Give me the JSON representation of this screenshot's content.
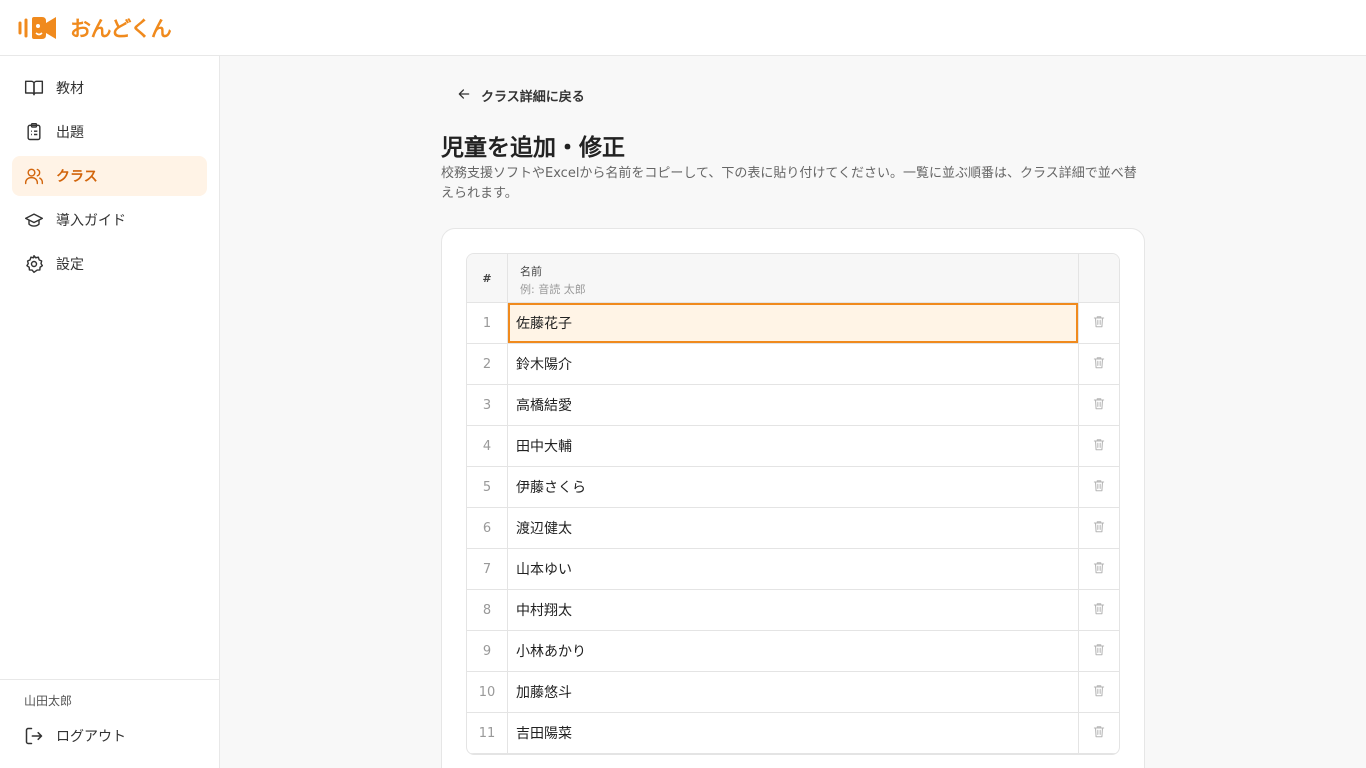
{
  "app": {
    "logo_text": "おんどくん"
  },
  "sidebar": {
    "items": [
      {
        "label": "教材",
        "icon": "book-icon",
        "active": false
      },
      {
        "label": "出題",
        "icon": "clipboard-icon",
        "active": false
      },
      {
        "label": "クラス",
        "icon": "users-icon",
        "active": true
      },
      {
        "label": "導入ガイド",
        "icon": "graduation-cap-icon",
        "active": false
      },
      {
        "label": "設定",
        "icon": "gear-icon",
        "active": false
      }
    ],
    "user_name": "山田太郎",
    "logout_label": "ログアウト"
  },
  "main": {
    "back_label": "クラス詳細に戻る",
    "title": "児童を追加・修正",
    "description": "校務支援ソフトやExcelから名前をコピーして、下の表に貼り付けてください。一覧に並ぶ順番は、クラス詳細で並べ替えられます。"
  },
  "table": {
    "col_num": "#",
    "col_name": "名前",
    "col_name_placeholder": "例: 音読 太郎",
    "rows": [
      {
        "num": "1",
        "name": "佐藤花子"
      },
      {
        "num": "2",
        "name": "鈴木陽介"
      },
      {
        "num": "3",
        "name": "高橋結愛"
      },
      {
        "num": "4",
        "name": "田中大輔"
      },
      {
        "num": "5",
        "name": "伊藤さくら"
      },
      {
        "num": "6",
        "name": "渡辺健太"
      },
      {
        "num": "7",
        "name": "山本ゆい"
      },
      {
        "num": "8",
        "name": "中村翔太"
      },
      {
        "num": "9",
        "name": "小林あかり"
      },
      {
        "num": "10",
        "name": "加藤悠斗"
      },
      {
        "num": "11",
        "name": "吉田陽菜"
      }
    ]
  },
  "colors": {
    "accent": "#f08a1d",
    "active_bg": "#fff3e6",
    "active_text": "#d2650c"
  }
}
